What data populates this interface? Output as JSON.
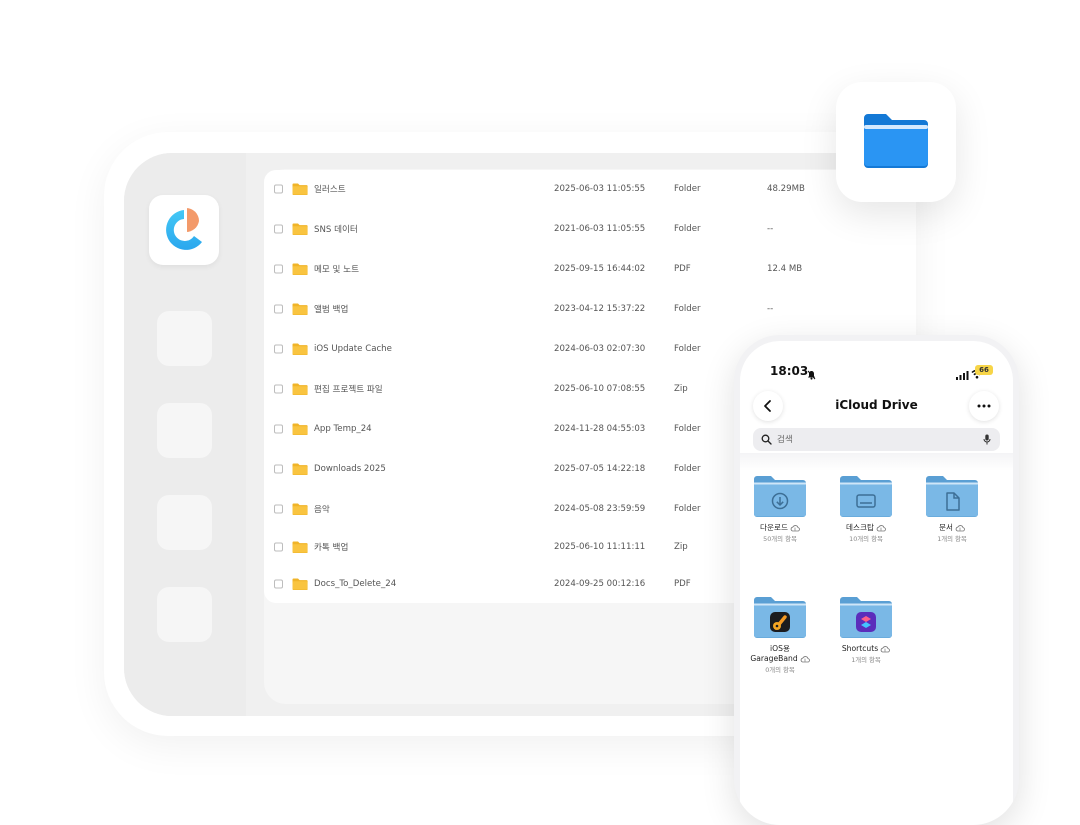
{
  "files": [
    {
      "name": "일러스트",
      "date": "2025-06-03 11:05:55",
      "type": "Folder",
      "size": "48.29MB"
    },
    {
      "name": "SNS 데이터",
      "date": "2021-06-03 11:05:55",
      "type": "Folder",
      "size": "--"
    },
    {
      "name": "메모 및 노트",
      "date": "2025-09-15 16:44:02",
      "type": "PDF",
      "size": "12.4 MB"
    },
    {
      "name": "앨범 백업",
      "date": "2023-04-12 15:37:22",
      "type": "Folder",
      "size": "--"
    },
    {
      "name": "iOS Update Cache",
      "date": "2024-06-03 02:07:30",
      "type": "Folder",
      "size": ""
    },
    {
      "name": "편집 프로젝트 파일",
      "date": "2025-06-10 07:08:55",
      "type": "Zip",
      "size": ""
    },
    {
      "name": "App Temp_24",
      "date": "2024-11-28 04:55:03",
      "type": "Folder",
      "size": ""
    },
    {
      "name": "Downloads 2025",
      "date": "2025-07-05 14:22:18",
      "type": "Folder",
      "size": ""
    },
    {
      "name": "음악",
      "date": "2024-05-08 23:59:59",
      "type": "Folder",
      "size": ""
    },
    {
      "name": "카톡 백업",
      "date": "2025-06-10 11:11:11",
      "type": "Zip",
      "size": ""
    },
    {
      "name": "Docs_To_Delete_24",
      "date": "2024-09-25 00:12:16",
      "type": "PDF",
      "size": ""
    }
  ],
  "phone": {
    "time": "18:03",
    "battery": "66",
    "title": "iCloud Drive",
    "search_placeholder": "검색",
    "items": [
      {
        "name": "다운로드",
        "count": "50개의 항목",
        "icon": "download-icon"
      },
      {
        "name": "데스크탑",
        "count": "10개의 항목",
        "icon": "desktop-icon"
      },
      {
        "name": "문서",
        "count": "1개의 항목",
        "icon": "document-icon"
      },
      {
        "name_line1": "iOS용",
        "name_line2": "GarageBand",
        "count": "0개의 항목",
        "icon": "garageband-app-icon"
      },
      {
        "name": "Shortcuts",
        "count": "1개의 항목",
        "icon": "shortcuts-app-icon"
      }
    ]
  },
  "colors": {
    "folder_yellow": "#f9c440",
    "folder_blue": "#7ab8e6",
    "files_app_blue": "#1e8cf0",
    "battery_yellow": "#f7d548"
  }
}
